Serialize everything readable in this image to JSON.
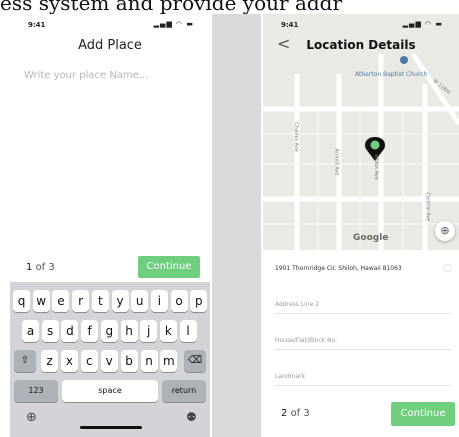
{
  "caption": "ess system and provide your addr",
  "left_phone": {
    "time": "9:41",
    "status_icons": "▂▄▆ ◠ ▬",
    "title": "Add Place",
    "input_placeholder": "Write your place Name...",
    "step_current": "1",
    "step_text": "of 3",
    "continue_label": "Continue",
    "keyboard": {
      "row1": [
        "q",
        "w",
        "e",
        "r",
        "t",
        "y",
        "u",
        "i",
        "o",
        "p"
      ],
      "row2": [
        "a",
        "s",
        "d",
        "f",
        "g",
        "h",
        "j",
        "k",
        "l"
      ],
      "row3": [
        "z",
        "x",
        "c",
        "v",
        "b",
        "n",
        "m"
      ],
      "shift": "⇧",
      "backspace": "⌫",
      "num": "123",
      "space": "space",
      "return": "return",
      "globe": "⊕",
      "mic": "⚉"
    }
  },
  "right_phone": {
    "time": "9:41",
    "status_icons": "▂▄▆ ◠ ▬",
    "title": "Location Details",
    "back_icon": "<",
    "map": {
      "poi": "Atherton Baptist Church",
      "streets": [
        "Charles Ave",
        "Arnold Ave",
        "Willox Ave",
        "Central Ave",
        "W 116th"
      ],
      "attribution": "Google"
    },
    "address": "1901 Thornridge Cir. Shiloh, Hawaii 81063",
    "fields": [
      {
        "placeholder": "Address Line 2",
        "value": ""
      },
      {
        "placeholder": "House/Flat/Block No.",
        "value": ""
      },
      {
        "placeholder": "Landmark",
        "value": ""
      }
    ],
    "step_current": "2",
    "step_text": "of 3",
    "continue_label": "Continue",
    "accent_color": "#6fcf7f"
  }
}
